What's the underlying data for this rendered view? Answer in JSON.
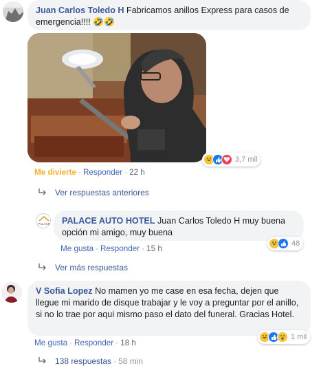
{
  "comment1": {
    "author": "Juan Carlos Toledo H",
    "text": "Fabricamos anillos Express para casos de emergencia!!!! 🤣🤣",
    "reaction_label": "Me divierte",
    "reply": "Responder",
    "time": "22 h",
    "reactions_count": "3,7 mil"
  },
  "prev_replies": "Ver respuestas anteriores",
  "comment2": {
    "author": "PALACE AUTO HOTEL",
    "text": "Juan Carlos Toledo H muy buena opción mi amigo, muy buena",
    "like": "Me gusta",
    "reply": "Responder",
    "time": "15 h",
    "reactions_count": "48",
    "avatar_text": "PALACE"
  },
  "more_replies": "Ver más respuestas",
  "comment3": {
    "author": "V Sofia Lopez",
    "text": "No mamen yo me case en esa fecha, dejen que llegue mi marido de disque trabajar y le voy a preguntar por el anillo, si no lo trae por aqui mismo paso el dato del funeral. Gracias Hotel.",
    "like": "Me gusta",
    "reply": "Responder",
    "time": "18 h",
    "reactions_count": "1 mil"
  },
  "replies_count": "138 respuestas",
  "replies_time": "58 min",
  "colors": {
    "link": "#385898",
    "action": "#4267b2",
    "haha": "#f7b125",
    "bubble": "#f2f3f5"
  }
}
